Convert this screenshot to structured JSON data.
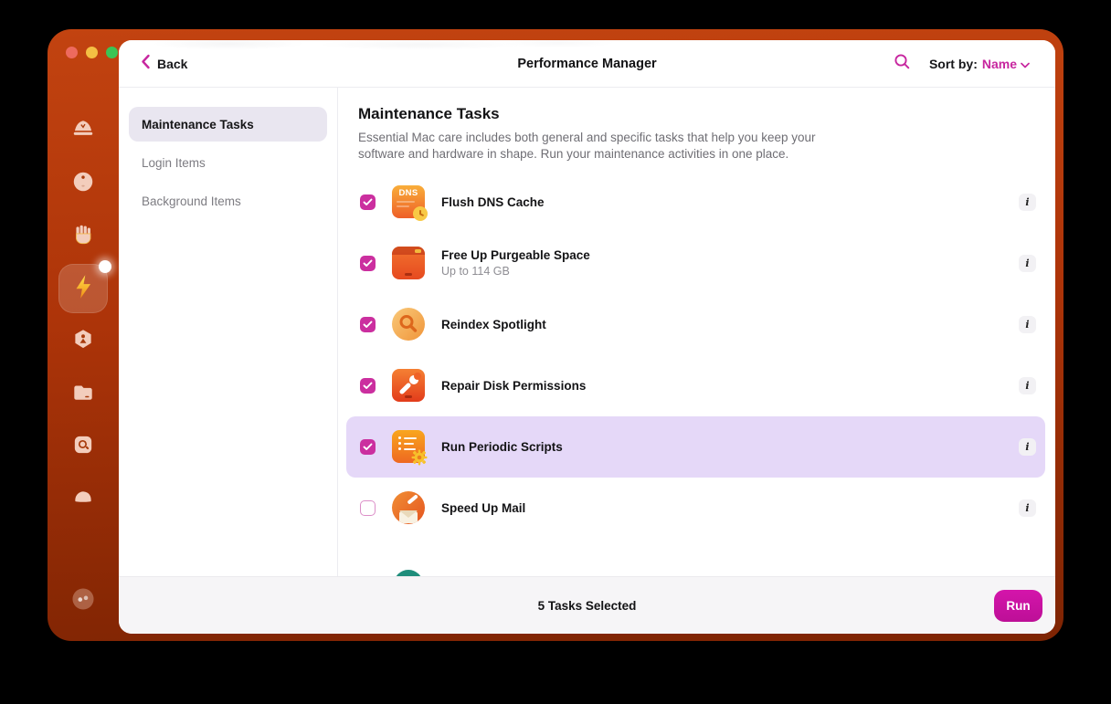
{
  "colors": {
    "accent_magenta": "#c7269f",
    "checkbox_checked": "#cb2f9f",
    "run_button": "#c912a4",
    "frame_orange_top": "#c24310",
    "frame_orange_bottom": "#7e2403",
    "highlight_row": "#e5d8f8",
    "nav_selected_pill": "#e9e6f0",
    "footer_bg": "#f6f5f7"
  },
  "window": {
    "traffic_lights": [
      "close",
      "minimize",
      "zoom"
    ]
  },
  "dock": {
    "items": [
      {
        "name": "cleanup"
      },
      {
        "name": "protection-orb"
      },
      {
        "name": "privacy-hand"
      },
      {
        "name": "performance",
        "selected": true,
        "has_notification_dot": true
      },
      {
        "name": "applications"
      },
      {
        "name": "files-folder"
      },
      {
        "name": "space-lens"
      },
      {
        "name": "shredder"
      },
      {
        "name": "assistant"
      }
    ]
  },
  "header": {
    "back_label": "Back",
    "title": "Performance Manager",
    "sort_label": "Sort by:",
    "sort_value": "Name"
  },
  "sidebar": {
    "items": [
      {
        "label": "Maintenance Tasks",
        "selected": true
      },
      {
        "label": "Login Items",
        "selected": false
      },
      {
        "label": "Background Items",
        "selected": false
      }
    ]
  },
  "main": {
    "title": "Maintenance Tasks",
    "description": "Essential Mac care includes both general and specific tasks that help you keep your software and hardware in shape. Run your maintenance activities in one place.",
    "info_glyph": "i",
    "tasks": [
      {
        "label": "Flush DNS Cache",
        "checked": true,
        "icon": "dns-clock-icon",
        "icon_text": "DNS"
      },
      {
        "label": "Free Up Purgeable Space",
        "sublabel": "Up to 114 GB",
        "checked": true,
        "icon": "hard-drive-icon"
      },
      {
        "label": "Reindex Spotlight",
        "checked": true,
        "icon": "spotlight-magnifier-icon"
      },
      {
        "label": "Repair Disk Permissions",
        "checked": true,
        "icon": "drive-wrench-icon"
      },
      {
        "label": "Run Periodic Scripts",
        "checked": true,
        "highlighted": true,
        "icon": "script-gear-icon"
      },
      {
        "label": "Speed Up Mail",
        "checked": false,
        "icon": "mail-envelope-icon"
      }
    ]
  },
  "footer": {
    "status": "5 Tasks Selected",
    "run_label": "Run"
  }
}
